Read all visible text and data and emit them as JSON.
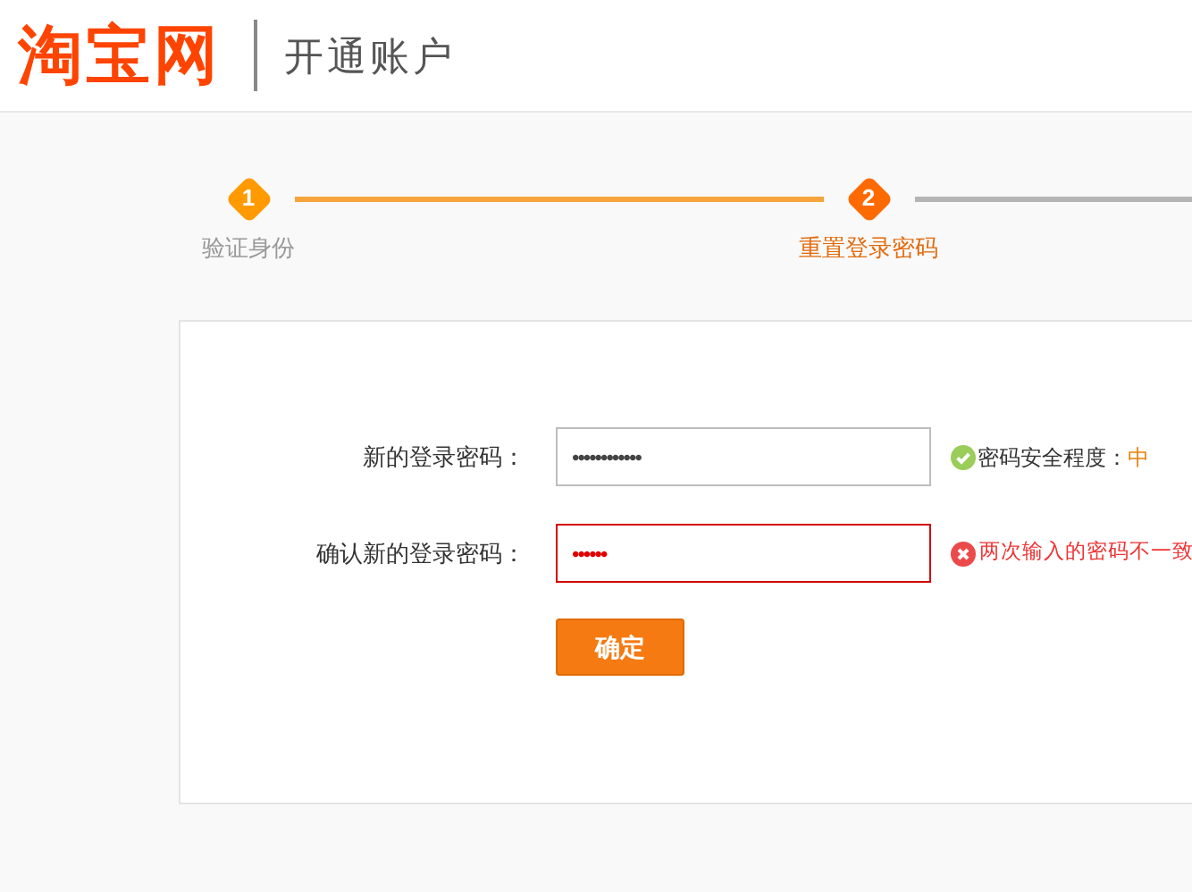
{
  "header": {
    "logo": "淘宝网",
    "title": "开通账户"
  },
  "steps": [
    {
      "number": "1",
      "label": "验证身份",
      "current": false
    },
    {
      "number": "2",
      "label": "重置登录密码",
      "current": true
    }
  ],
  "form": {
    "fields": [
      {
        "label": "新的登录密码：",
        "value": "••••••••••••",
        "error": false,
        "message": "密码安全程度：",
        "strength": "中"
      },
      {
        "label": "确认新的登录密码：",
        "value": "••••••",
        "error": true,
        "message": "两次输入的密码不一致"
      }
    ],
    "submit": "确定"
  }
}
